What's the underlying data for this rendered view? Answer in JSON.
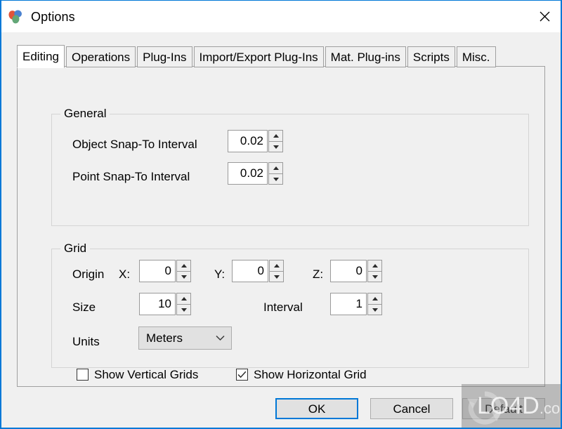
{
  "window": {
    "title": "Options",
    "app_icon": "three-leaf-logo-icon",
    "close_label": "✕",
    "border_color": "#0078d7"
  },
  "tabs": [
    {
      "label": "Editing",
      "active": true,
      "name": "tab-editing"
    },
    {
      "label": "Operations",
      "active": false,
      "name": "tab-operations"
    },
    {
      "label": "Plug-Ins",
      "active": false,
      "name": "tab-plug-ins"
    },
    {
      "label": "Import/Export Plug-Ins",
      "active": false,
      "name": "tab-import-export-plug-ins"
    },
    {
      "label": "Mat. Plug-ins",
      "active": false,
      "name": "tab-mat-plug-ins"
    },
    {
      "label": "Scripts",
      "active": false,
      "name": "tab-scripts"
    },
    {
      "label": "Misc.",
      "active": false,
      "name": "tab-misc"
    }
  ],
  "general": {
    "group_title": "General",
    "object_snap": {
      "label": "Object Snap-To Interval",
      "value": "0.02"
    },
    "point_snap": {
      "label": "Point Snap-To Interval",
      "value": "0.02"
    }
  },
  "grid": {
    "group_title": "Grid",
    "origin_label": "Origin",
    "origin_x": {
      "label": "X:",
      "value": "0"
    },
    "origin_y": {
      "label": "Y:",
      "value": "0"
    },
    "origin_z": {
      "label": "Z:",
      "value": "0"
    },
    "size": {
      "label": "Size",
      "value": "10"
    },
    "interval": {
      "label": "Interval",
      "value": "1"
    },
    "units": {
      "label": "Units",
      "value": "Meters",
      "options": [
        "Meters"
      ]
    },
    "show_vertical_grids": {
      "label": "Show Vertical Grids",
      "checked": false
    },
    "show_horizontal_grid": {
      "label": "Show Horizontal Grid",
      "checked": true
    }
  },
  "buttons": {
    "ok": "OK",
    "cancel": "Cancel",
    "default": "Default"
  },
  "watermark": {
    "text": "LO4D",
    "suffix": ".com"
  }
}
